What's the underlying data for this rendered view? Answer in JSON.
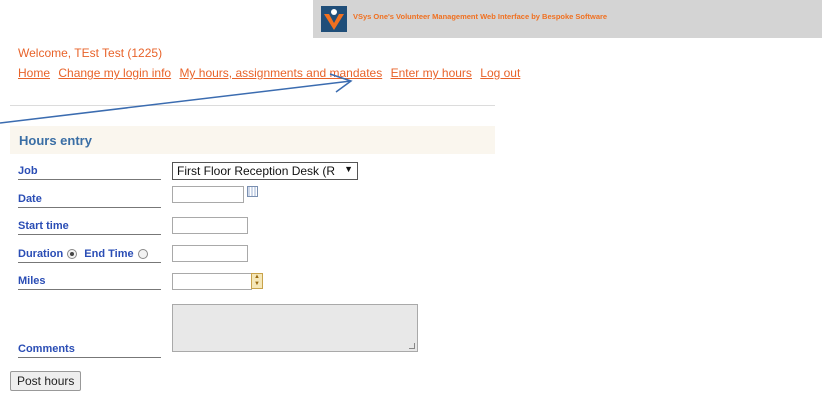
{
  "banner": {
    "text": "VSys One's Volunteer Management Web Interface by Bespoke Software",
    "logo_icon": "vsys-logo-icon",
    "accent_color": "#f07020"
  },
  "header": {
    "welcome": "Welcome, TEst Test (1225)",
    "nav": [
      "Home",
      "Change my login info",
      "My hours, assignments and mandates",
      "Enter my hours",
      "Log out"
    ]
  },
  "form": {
    "title": "Hours entry",
    "job_label": "Job",
    "job_value": "First Floor Reception Desk (R",
    "date_label": "Date",
    "date_value": "",
    "start_label": "Start time",
    "start_value": "",
    "duration_label": "Duration",
    "end_label": "End Time",
    "duration_selected": true,
    "duration_value": "",
    "miles_label": "Miles",
    "miles_value": "",
    "comments_label": "Comments",
    "comments_value": "",
    "submit_label": "Post hours"
  },
  "colors": {
    "nav_link": "#e8632a",
    "label": "#2a4db5",
    "section_title": "#3a6ea5",
    "annotation_arrow": "#3b6cb0"
  }
}
